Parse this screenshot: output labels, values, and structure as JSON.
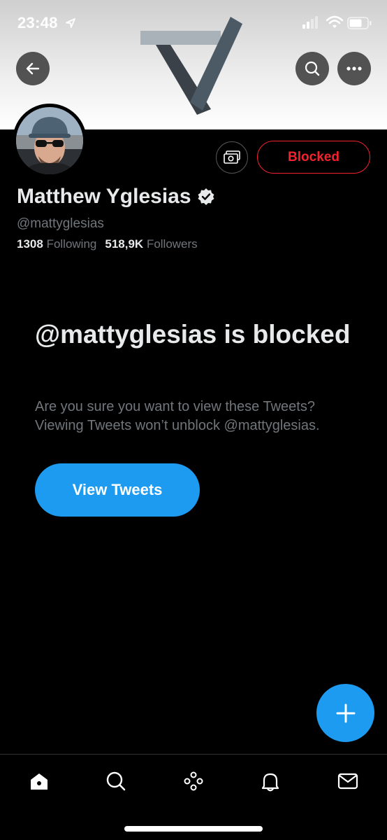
{
  "status_bar": {
    "time": "23:48",
    "icons": [
      "location-arrow-icon",
      "signal-icon",
      "wifi-icon",
      "battery-icon"
    ]
  },
  "header": {
    "back_icon": "arrow-left-icon",
    "search_icon": "search-icon",
    "more_icon": "ellipsis-icon"
  },
  "profile": {
    "name": "Matthew Yglesias",
    "handle": "@mattyglesias",
    "following_count": "1308",
    "following_label": "Following",
    "followers_count": "518,9K",
    "followers_label": "Followers",
    "verified": true
  },
  "actions": {
    "tip_icon": "money-icon",
    "blocked_label": "Blocked"
  },
  "blocked_notice": {
    "title": "@mattyglesias is blocked",
    "description": "Are you sure you want to view these Tweets? Viewing Tweets won’t unblock @mattyglesias.",
    "button_label": "View Tweets"
  },
  "fab": {
    "icon": "plus-icon"
  },
  "tab_bar": {
    "items": [
      "home-icon",
      "search-icon",
      "spaces-icon",
      "bell-icon",
      "mail-icon"
    ]
  },
  "colors": {
    "accent": "#1d9bf0",
    "blocked_red": "#f4212e",
    "background": "#000000",
    "secondary_text": "#71767b"
  }
}
